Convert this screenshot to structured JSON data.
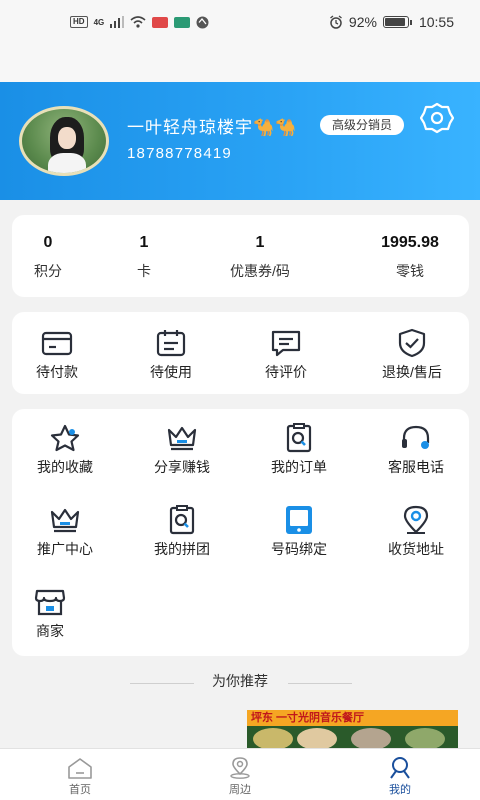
{
  "status_bar": {
    "hd": "HD",
    "network": "4G",
    "battery": "92%",
    "battery_level": 0.92,
    "time": "10:55"
  },
  "profile": {
    "username": "一叶轻舟琼楼宇🐪🐪",
    "level": "高级分销员",
    "phone": "18788778419"
  },
  "stats": [
    {
      "value": "0",
      "label": "积分"
    },
    {
      "value": "1",
      "label": "卡"
    },
    {
      "value": "1",
      "label": "优惠券/码"
    },
    {
      "value": "1995.98",
      "label": "零钱"
    }
  ],
  "orders": [
    {
      "label": "待付款",
      "icon": "wallet-icon"
    },
    {
      "label": "待使用",
      "icon": "calendar-icon"
    },
    {
      "label": "待评价",
      "icon": "comment-icon"
    },
    {
      "label": "退换/售后",
      "icon": "shield-icon"
    }
  ],
  "services": [
    {
      "label": "我的收藏",
      "icon": "star-icon"
    },
    {
      "label": "分享赚钱",
      "icon": "crown-icon"
    },
    {
      "label": "我的订单",
      "icon": "order-search-icon"
    },
    {
      "label": "客服电话",
      "icon": "headset-icon"
    },
    {
      "label": "推广中心",
      "icon": "crown-outline-icon"
    },
    {
      "label": "我的拼团",
      "icon": "group-search-icon"
    },
    {
      "label": "号码绑定",
      "icon": "phone-bind-icon"
    },
    {
      "label": "收货地址",
      "icon": "location-icon"
    },
    {
      "label": "商家",
      "icon": "store-icon"
    }
  ],
  "recommend": {
    "title": "为你推荐",
    "banner_text": "坪东  一寸光阴音乐餐厅"
  },
  "nav": [
    {
      "label": "首页",
      "icon": "home-icon"
    },
    {
      "label": "周边",
      "icon": "nearby-icon"
    },
    {
      "label": "我的",
      "icon": "profile-icon"
    }
  ],
  "colors": {
    "brand_blue": "#1a8fe6",
    "accent_dark_blue": "#1a4f9c",
    "icon_dark": "#2a2f3a"
  }
}
